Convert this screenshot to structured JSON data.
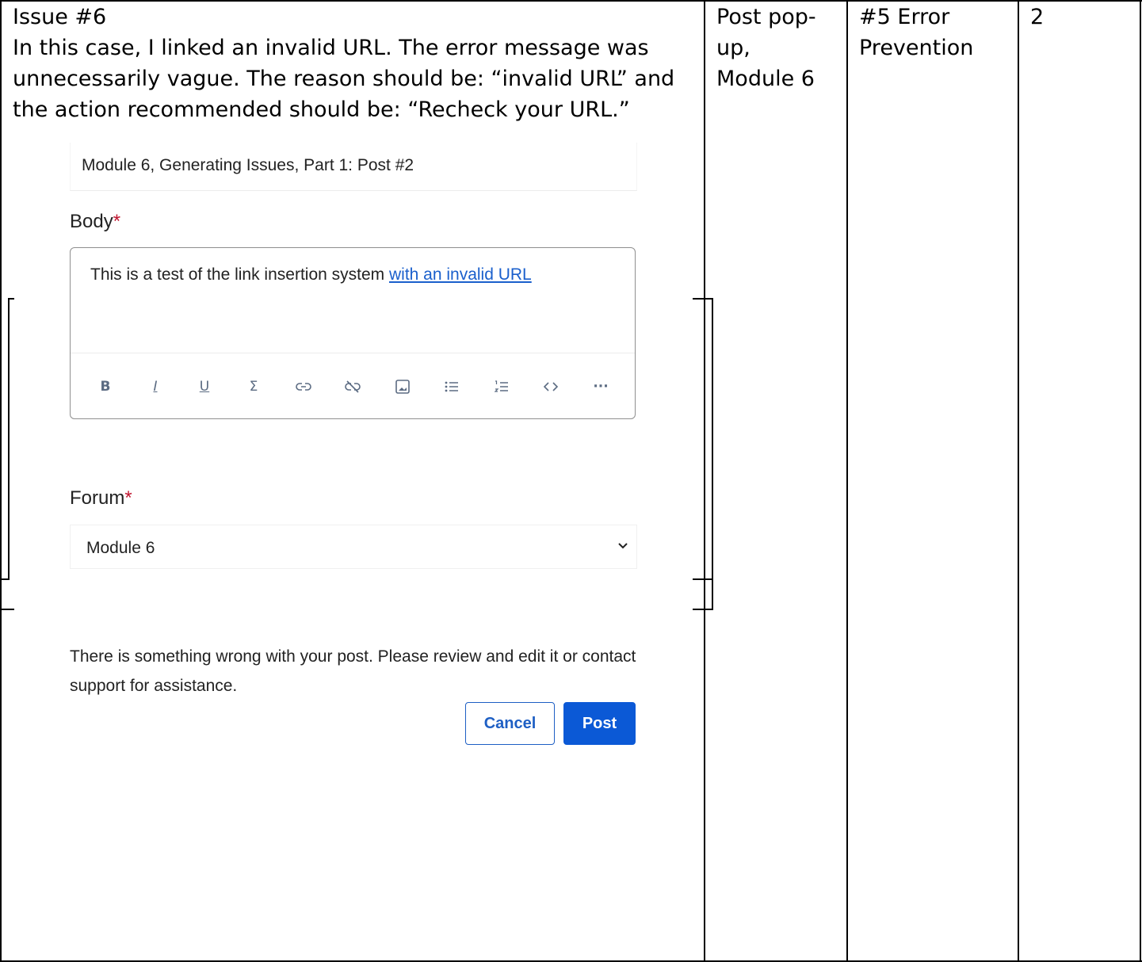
{
  "row": {
    "issue_title": "Issue #6",
    "issue_description": "In this case, I linked an invalid URL. The error message was unnecessarily vague. The reason should be: “invalid URL” and the action recommended should be: “Recheck your URL.”",
    "location": "Post pop-\nup,\nModule 6",
    "heuristic": "#5 Error\nPrevention",
    "severity": "2"
  },
  "screenshot": {
    "title_value": "Module 6, Generating Issues, Part 1: Post #2",
    "body_label": "Body",
    "required_mark": "*",
    "body_text": "This is a test of the link insertion system ",
    "body_link": "with an invalid URL",
    "toolbar": [
      "bold-icon",
      "italic-icon",
      "underline-icon",
      "sigma-icon",
      "link-icon",
      "unlink-icon",
      "image-icon",
      "bullet-list-icon",
      "numbered-list-icon",
      "code-icon",
      "more-icon"
    ],
    "forum_label": "Forum",
    "forum_value": "Module 6",
    "error_message": "There is something wrong with your post. Please review and edit it or contact support for assistance.",
    "cancel_label": "Cancel",
    "post_label": "Post"
  }
}
